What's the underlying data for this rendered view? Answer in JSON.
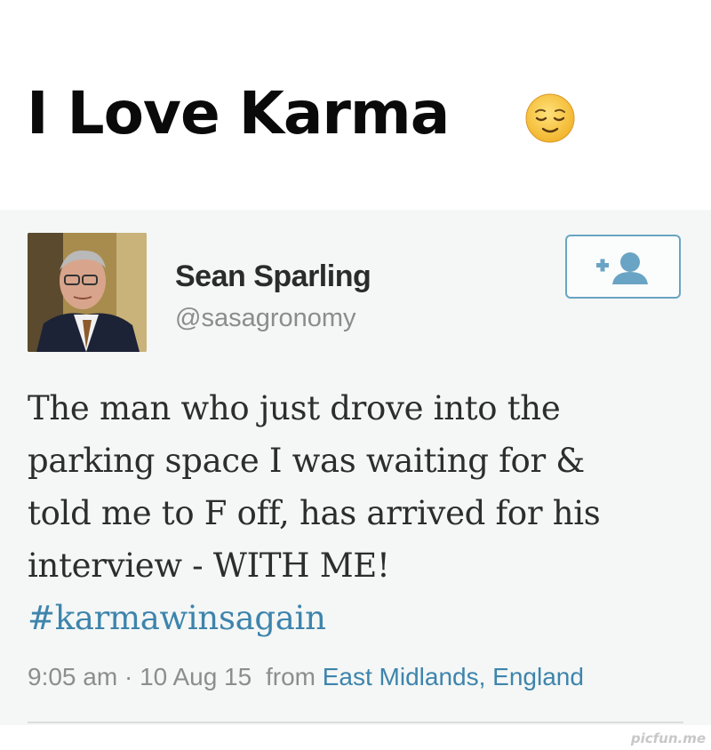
{
  "header": {
    "title": "I Love Karma",
    "emoji_icon": "relieved-face-emoji"
  },
  "tweet": {
    "display_name": "Sean Sparling",
    "handle": "@sasagronomy",
    "follow_icon": "add-user-icon",
    "text_lines": [
      "The man who just drove into the",
      "parking space I was waiting for &",
      "told me to F off, has arrived for his",
      "interview - WITH ME!"
    ],
    "hashtag": "#karmawinsagain",
    "time": "9:05 am",
    "separator": "·",
    "date": "10 Aug 15",
    "from_label": "from",
    "location": "East Midlands, England"
  },
  "watermark": "picfun.me",
  "colors": {
    "link": "#3e84ac",
    "tweet_bg": "#f4f7f6",
    "button_border": "#6aa4c4"
  }
}
